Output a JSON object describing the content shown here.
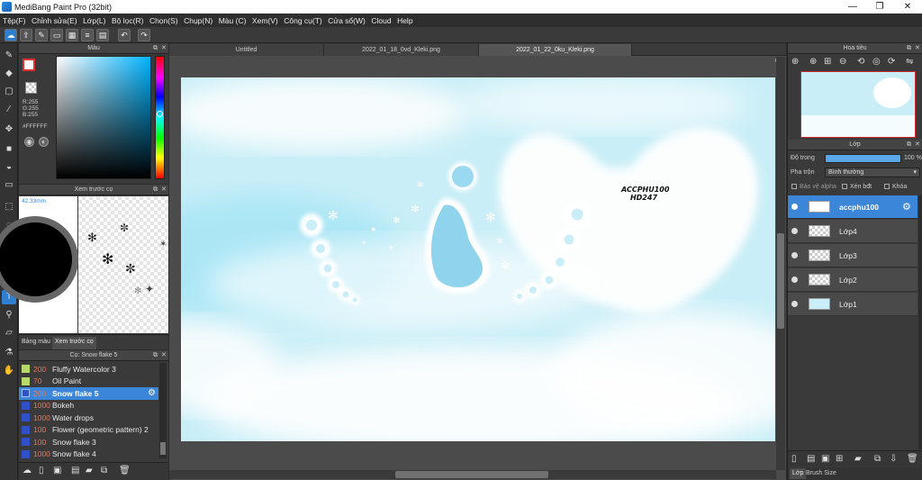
{
  "window": {
    "title": "MediBang Paint Pro (32bit)",
    "minimize": "—",
    "maximize": "❐",
    "close": "✕"
  },
  "menu": [
    "Tệp(F)",
    "Chỉnh sửa(E)",
    "Lớp(L)",
    "Bộ lọc(R)",
    "Chọn(S)",
    "Chụp(N)",
    "Màu (C)",
    "Xem(V)",
    "Công cụ(T)",
    "Cửa sổ(W)",
    "Cloud",
    "Help"
  ],
  "color_panel": {
    "title": "Màu",
    "rgb": [
      "R:255",
      "G:255",
      "B:255"
    ],
    "hex": "#FFFFFF"
  },
  "preview_panel": {
    "title": "Xem trước cọ",
    "size": "42.33mm",
    "tabs": [
      "Bảng màu",
      "Xem trước cọ"
    ]
  },
  "brush_panel": {
    "title": "Cọ: Snow flake 5",
    "items": [
      {
        "size": "200",
        "name": "Fluffy Watercolor 3",
        "color": "#b8d86a"
      },
      {
        "size": "70",
        "name": "Oil Paint",
        "color": "#b8d86a"
      },
      {
        "size": "200",
        "name": "Snow flake 5",
        "color": "#3050c8",
        "selected": true
      },
      {
        "size": "1000",
        "name": "Bokeh",
        "color": "#3050c8"
      },
      {
        "size": "1000",
        "name": "Water drops",
        "color": "#3050c8"
      },
      {
        "size": "100",
        "name": "Flower (geometric pattern) 2",
        "color": "#3050c8"
      },
      {
        "size": "100",
        "name": "Snow flake 3",
        "color": "#3050c8"
      },
      {
        "size": "1000",
        "name": "Snow flake 4",
        "color": "#3050c8"
      }
    ]
  },
  "canvas": {
    "tabs": [
      "Untitled",
      "2022_01_18_0vd_Kleki.png",
      "2022_01_22_0ku_Kleki.png"
    ],
    "active_tab": 2,
    "text_lines": [
      "ACCPHU100",
      "HD247"
    ]
  },
  "navigator": {
    "title": "Hoa tiêu"
  },
  "layer_panel": {
    "title": "Lớp",
    "opacity_label": "Độ trong",
    "opacity_value": "100 %",
    "opacity": 100,
    "blend_label": "Pha trộn",
    "blend_value": "Bình thường",
    "protect_alpha": "Bảo vệ alpha",
    "clipping": "Xén bđt",
    "lock": "Khóa",
    "layers": [
      {
        "name": "accphu100",
        "selected": true
      },
      {
        "name": "Lớp4"
      },
      {
        "name": "Lớp3"
      },
      {
        "name": "Lớp2"
      },
      {
        "name": "Lớp1"
      }
    ],
    "bottom_tabs": [
      "Lớp",
      "Brush Size"
    ]
  },
  "colors": {
    "accent": "#3b86d8",
    "canvas_sky": "#c9eef7"
  }
}
